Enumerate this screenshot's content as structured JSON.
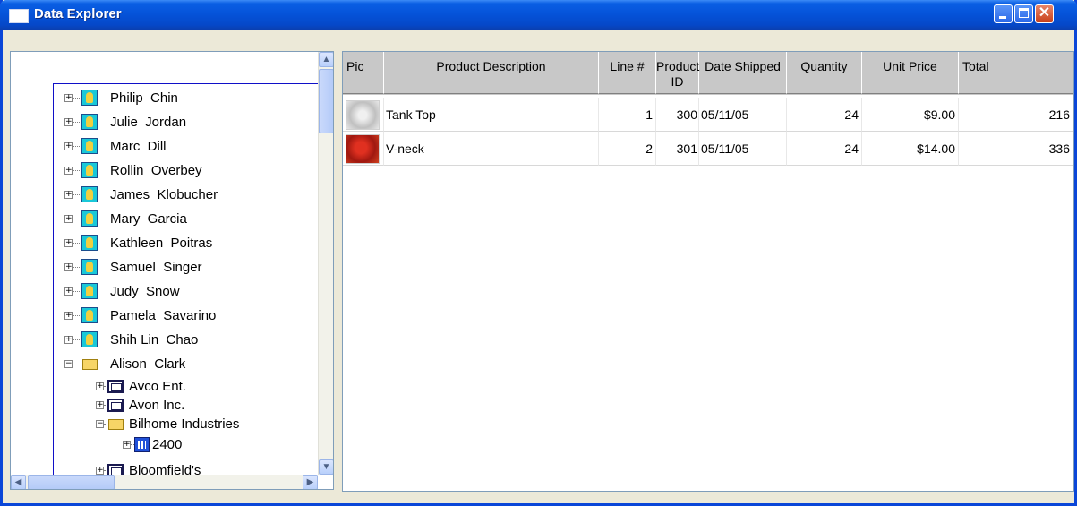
{
  "window": {
    "title": "Data Explorer"
  },
  "tree": {
    "items": [
      {
        "label": "Philip  Chin",
        "type": "person",
        "expander": "+"
      },
      {
        "label": "Julie  Jordan",
        "type": "person",
        "expander": "+"
      },
      {
        "label": "Marc  Dill",
        "type": "person",
        "expander": "+"
      },
      {
        "label": "Rollin  Overbey",
        "type": "person",
        "expander": "+"
      },
      {
        "label": "James  Klobucher",
        "type": "person",
        "expander": "+"
      },
      {
        "label": "Mary  Garcia",
        "type": "person",
        "expander": "+"
      },
      {
        "label": "Kathleen  Poitras",
        "type": "person",
        "expander": "+"
      },
      {
        "label": "Samuel  Singer",
        "type": "person",
        "expander": "+"
      },
      {
        "label": "Judy  Snow",
        "type": "person",
        "expander": "+"
      },
      {
        "label": "Pamela  Savarino",
        "type": "person",
        "expander": "+"
      },
      {
        "label": "Shih Lin  Chao",
        "type": "person",
        "expander": "+"
      },
      {
        "label": "Alison  Clark",
        "type": "folder",
        "expander": "−"
      },
      {
        "label": "Avco Ent.",
        "type": "company",
        "expander": "+"
      },
      {
        "label": "Avon Inc.",
        "type": "company",
        "expander": "+"
      },
      {
        "label": "Bilhome Industries",
        "type": "folder",
        "expander": "−"
      },
      {
        "label": "2400",
        "type": "order",
        "expander": "+"
      },
      {
        "label": "Bloomfield's",
        "type": "company",
        "expander": "+"
      }
    ]
  },
  "grid": {
    "columns": [
      "Pic",
      "Product Description",
      "Line #",
      "Product ID",
      "Date Shipped",
      "Quantity",
      "Unit Price",
      "Total"
    ],
    "rows": [
      {
        "pic": "tank-top-image",
        "description": "Tank Top",
        "line": "1",
        "product_id": "300",
        "date": "05/11/05",
        "quantity": "24",
        "unit_price": "$9.00",
        "total": "216"
      },
      {
        "pic": "v-neck-image",
        "description": "V-neck",
        "line": "2",
        "product_id": "301",
        "date": "05/11/05",
        "quantity": "24",
        "unit_price": "$14.00",
        "total": "336"
      }
    ]
  },
  "colors": {
    "titlebar": "#0552d8",
    "header_bg": "#c8c8c8"
  }
}
